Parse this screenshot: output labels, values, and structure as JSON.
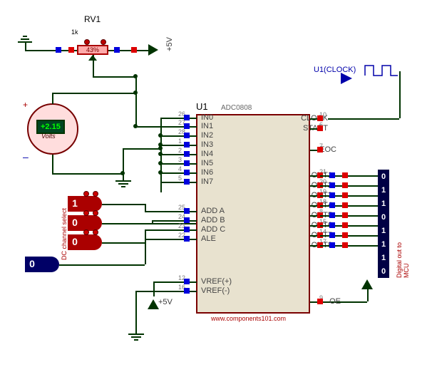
{
  "pot": {
    "ref": "RV1",
    "value_label": "1k",
    "percent": "43%"
  },
  "rail_labels": {
    "pos5_top": "+5V",
    "pos5_mid": "+5V"
  },
  "voltmeter": {
    "reading": "+2.15",
    "unit": "Volts",
    "plus": "+",
    "minus": "–"
  },
  "clock_gen": {
    "label": "U1(CLOCK)"
  },
  "adc_selector_label": "DC channel select",
  "selector_bits": [
    "1",
    "0",
    "0"
  ],
  "ale_bit": "0",
  "ic": {
    "ref": "U1",
    "part": "ADC0808",
    "footer": "www.components101.com",
    "left_pins": [
      {
        "num": "26",
        "label": "IN0"
      },
      {
        "num": "27",
        "label": "IN1"
      },
      {
        "num": "28",
        "label": "IN2"
      },
      {
        "num": "1",
        "label": "IN3"
      },
      {
        "num": "2",
        "label": "IN4"
      },
      {
        "num": "3",
        "label": "IN5"
      },
      {
        "num": "4",
        "label": "IN6"
      },
      {
        "num": "5",
        "label": "IN7"
      },
      {
        "num": "25",
        "label": "ADD A"
      },
      {
        "num": "24",
        "label": "ADD B"
      },
      {
        "num": "23",
        "label": "ADD C"
      },
      {
        "num": "22",
        "label": "ALE"
      },
      {
        "num": "12",
        "label": "VREF(+)"
      },
      {
        "num": "16",
        "label": "VREF(-)"
      }
    ],
    "right_pins": [
      {
        "num": "10",
        "label": "CLOCK"
      },
      {
        "num": "6",
        "label": "START"
      },
      {
        "num": "7",
        "label": "EOC"
      },
      {
        "num": "21",
        "label": "OUT1"
      },
      {
        "num": "20",
        "label": "OUT2"
      },
      {
        "num": "19",
        "label": "OUT3"
      },
      {
        "num": "18",
        "label": "OUT4"
      },
      {
        "num": "8",
        "label": "OUT5"
      },
      {
        "num": "15",
        "label": "OUT6"
      },
      {
        "num": "14",
        "label": "OUT7"
      },
      {
        "num": "17",
        "label": "OUT8"
      },
      {
        "num": "9",
        "label": "OE"
      }
    ]
  },
  "digital_out_label": "Digital out to MCU",
  "digital_out_bits": [
    "0",
    "1",
    "1",
    "0",
    "1",
    "1",
    "1",
    "0"
  ]
}
